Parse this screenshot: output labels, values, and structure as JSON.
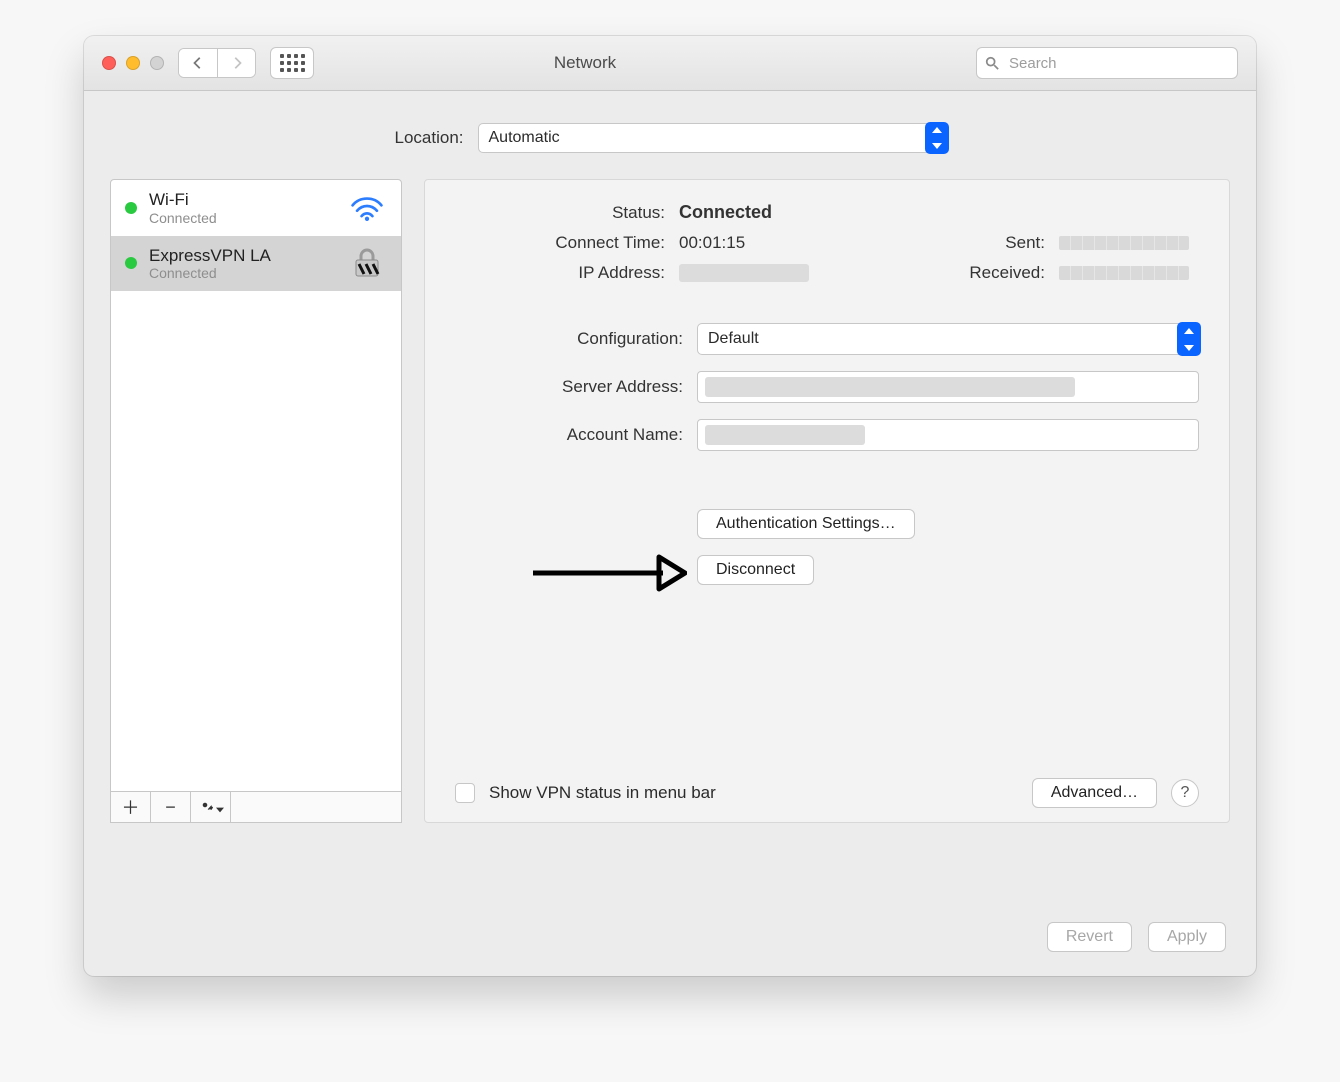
{
  "window": {
    "title": "Network",
    "search_placeholder": "Search"
  },
  "location": {
    "label": "Location:",
    "value": "Automatic"
  },
  "services": [
    {
      "name": "Wi-Fi",
      "status": "Connected",
      "kind": "wifi",
      "selected": false
    },
    {
      "name": "ExpressVPN LA",
      "status": "Connected",
      "kind": "vpn",
      "selected": true
    }
  ],
  "status": {
    "status_label": "Status:",
    "status_value": "Connected",
    "connect_time_label": "Connect Time:",
    "connect_time_value": "00:01:15",
    "ip_label": "IP Address:",
    "sent_label": "Sent:",
    "received_label": "Received:"
  },
  "form": {
    "configuration_label": "Configuration:",
    "configuration_value": "Default",
    "server_address_label": "Server Address:",
    "account_name_label": "Account Name:"
  },
  "buttons": {
    "authentication": "Authentication Settings…",
    "disconnect": "Disconnect",
    "advanced": "Advanced…",
    "revert": "Revert",
    "apply": "Apply"
  },
  "checkbox": {
    "show_vpn_label": "Show VPN status in menu bar"
  }
}
